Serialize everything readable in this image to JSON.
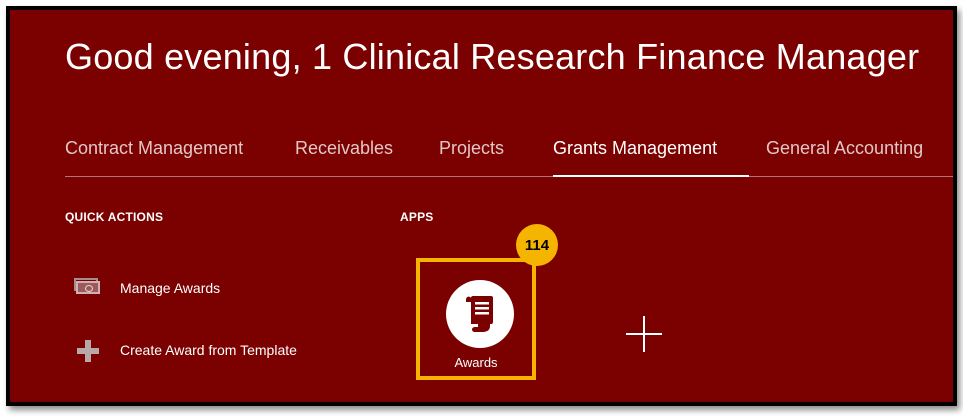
{
  "header": {
    "greeting": "Good evening, 1 Clinical Research Finance Manager"
  },
  "tabs": [
    {
      "label": "Contract Management",
      "active": false
    },
    {
      "label": "Receivables",
      "active": false
    },
    {
      "label": "Projects",
      "active": false
    },
    {
      "label": "Grants Management",
      "active": true
    },
    {
      "label": "General Accounting",
      "active": false
    }
  ],
  "quick_actions": {
    "title": "QUICK ACTIONS",
    "items": [
      {
        "label": "Manage Awards",
        "icon": "money-icon"
      },
      {
        "label": "Create Award from Template",
        "icon": "plus-icon"
      }
    ]
  },
  "apps": {
    "title": "APPS",
    "items": [
      {
        "label": "Awards",
        "icon": "scroll-icon",
        "badge": "114"
      }
    ],
    "add_icon": "plus-icon"
  },
  "colors": {
    "background": "#7b0000",
    "highlight": "#f4b400",
    "text": "#ffffff"
  }
}
